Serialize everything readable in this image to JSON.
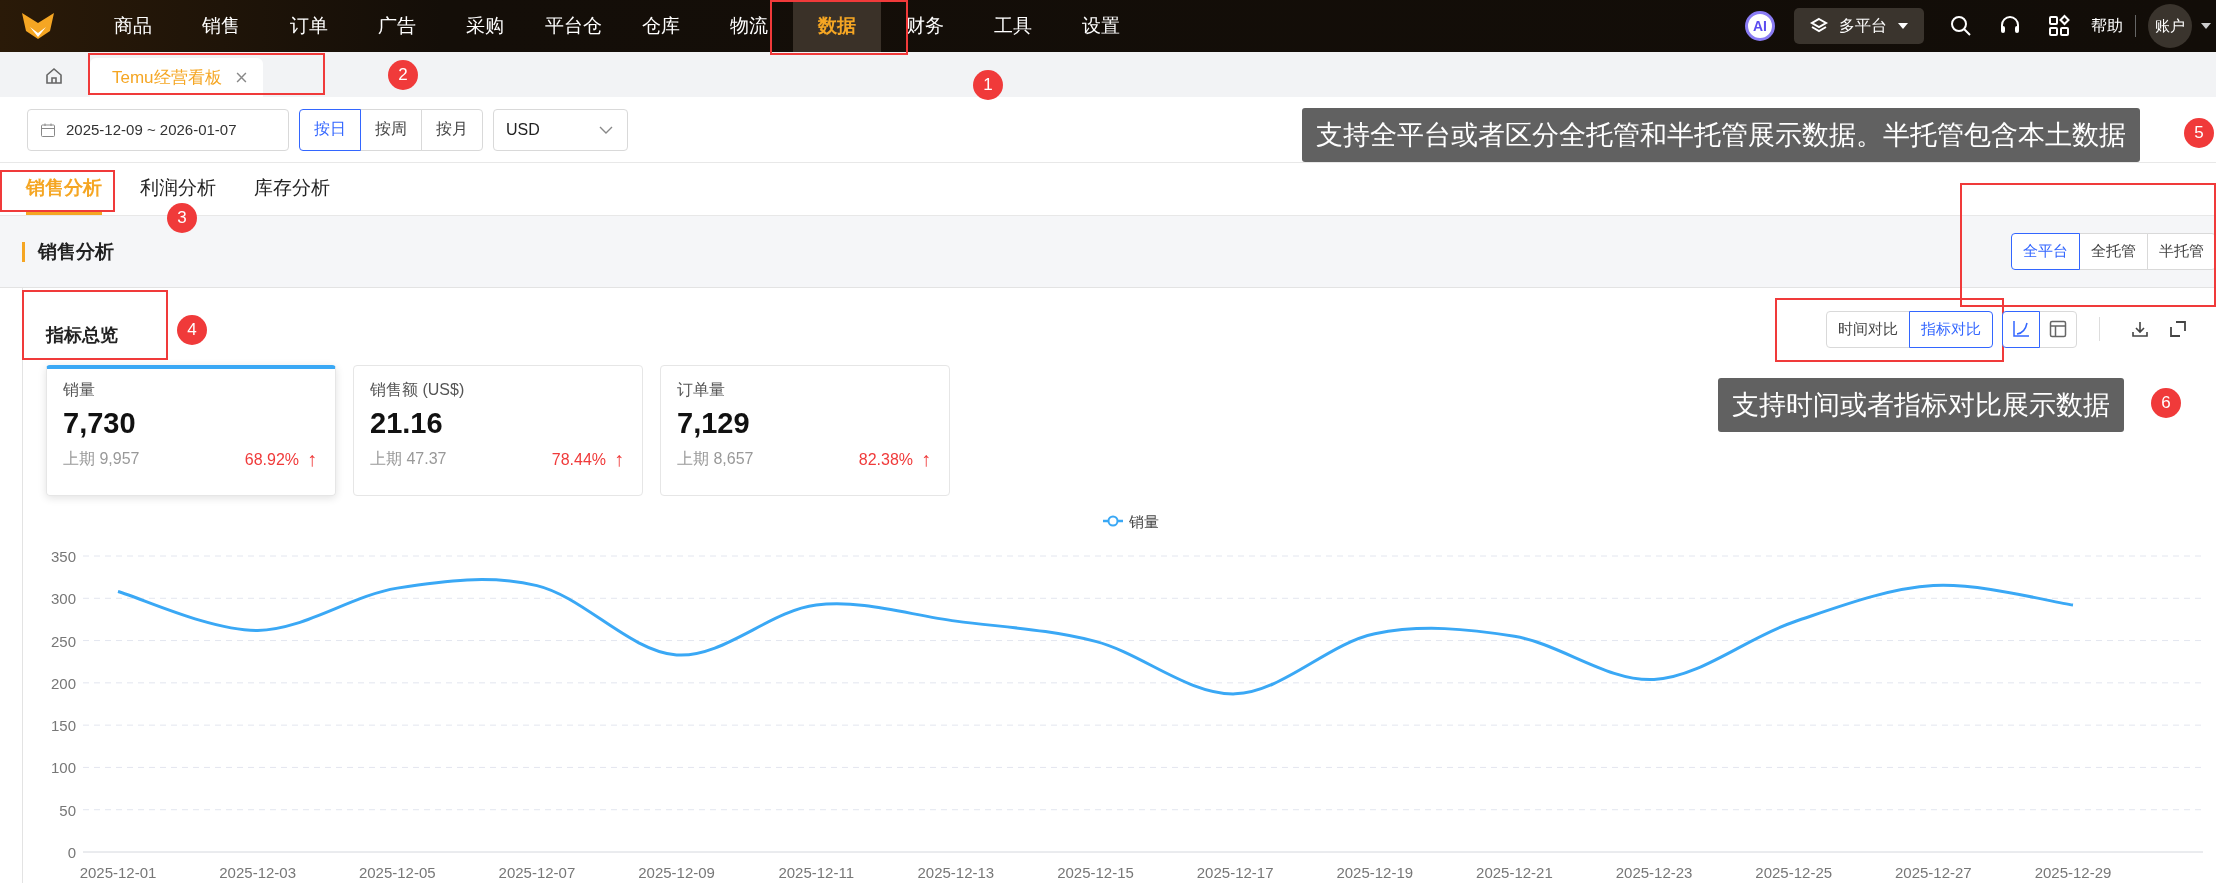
{
  "nav": {
    "items": [
      {
        "label": "商品",
        "selected": false
      },
      {
        "label": "销售",
        "selected": false
      },
      {
        "label": "订单",
        "selected": false
      },
      {
        "label": "广告",
        "selected": false
      },
      {
        "label": "采购",
        "selected": false
      },
      {
        "label": "平台仓",
        "selected": false
      },
      {
        "label": "仓库",
        "selected": false
      },
      {
        "label": "物流",
        "selected": false
      },
      {
        "label": "数据",
        "selected": true
      },
      {
        "label": "财务",
        "selected": false
      },
      {
        "label": "工具",
        "selected": false
      },
      {
        "label": "设置",
        "selected": false
      }
    ],
    "ai_badge": "AI",
    "platform_selector": "多平台",
    "help": "帮助",
    "account": "账户"
  },
  "page_tabs": [
    {
      "label": "Temu经营看板",
      "selected": true
    }
  ],
  "filters": {
    "date_range": "2025-12-09 ~ 2026-01-07",
    "granularity": [
      {
        "label": "按日",
        "selected": true
      },
      {
        "label": "按周",
        "selected": false
      },
      {
        "label": "按月",
        "selected": false
      }
    ],
    "currency": "USD"
  },
  "analysis_tabs": [
    {
      "label": "销售分析",
      "selected": true
    },
    {
      "label": "利润分析",
      "selected": false
    },
    {
      "label": "库存分析",
      "selected": false
    }
  ],
  "section": {
    "title": "销售分析",
    "platform_filter": [
      {
        "label": "全平台",
        "selected": true
      },
      {
        "label": "全托管",
        "selected": false
      },
      {
        "label": "半托管",
        "selected": false
      }
    ]
  },
  "overview": {
    "title": "指标总览",
    "compare_modes": [
      {
        "label": "时间对比",
        "selected": false
      },
      {
        "label": "指标对比",
        "selected": true
      }
    ],
    "view_modes": [
      {
        "kind": "chart",
        "selected": true
      },
      {
        "kind": "table",
        "selected": false
      }
    ],
    "metrics": [
      {
        "label": "销量",
        "value": "7,730",
        "previous": "上期 9,957",
        "change": "68.92%",
        "arrow": "↑",
        "selected": true
      },
      {
        "label": "销售额 (US$)",
        "value": "21.16",
        "previous": "上期 47.37",
        "change": "78.44%",
        "arrow": "↑",
        "selected": false
      },
      {
        "label": "订单量",
        "value": "7,129",
        "previous": "上期 8,657",
        "change": "82.38%",
        "arrow": "↑",
        "selected": false
      }
    ],
    "chart_data": {
      "type": "line",
      "grid": true,
      "categories": [
        "2025-12-01",
        "2025-12-03",
        "2025-12-05",
        "2025-12-07",
        "2025-12-09",
        "2025-12-11",
        "2025-12-13",
        "2025-12-15",
        "2025-12-17",
        "2025-12-19",
        "2025-12-21",
        "2025-12-23",
        "2025-12-25",
        "2025-12-27",
        "2025-12-29"
      ],
      "series": [
        {
          "name": "销量",
          "color": "#3aa8f5",
          "values": [
            308,
            262,
            312,
            315,
            233,
            292,
            273,
            249,
            187,
            258,
            255,
            204,
            272,
            315,
            292
          ]
        }
      ],
      "ylim": [
        0,
        350
      ],
      "yticks": [
        0,
        50,
        100,
        150,
        200,
        250,
        300,
        350
      ]
    }
  },
  "annotations": {
    "markers": [
      {
        "number": "1"
      },
      {
        "number": "2"
      },
      {
        "number": "3"
      },
      {
        "number": "4"
      },
      {
        "number": "5"
      },
      {
        "number": "6"
      }
    ],
    "tooltips": [
      {
        "text": "支持全平台或者区分全托管和半托管展示数据。半托管包含本土数据"
      },
      {
        "text": "支持时间或者指标对比展示数据"
      }
    ]
  }
}
